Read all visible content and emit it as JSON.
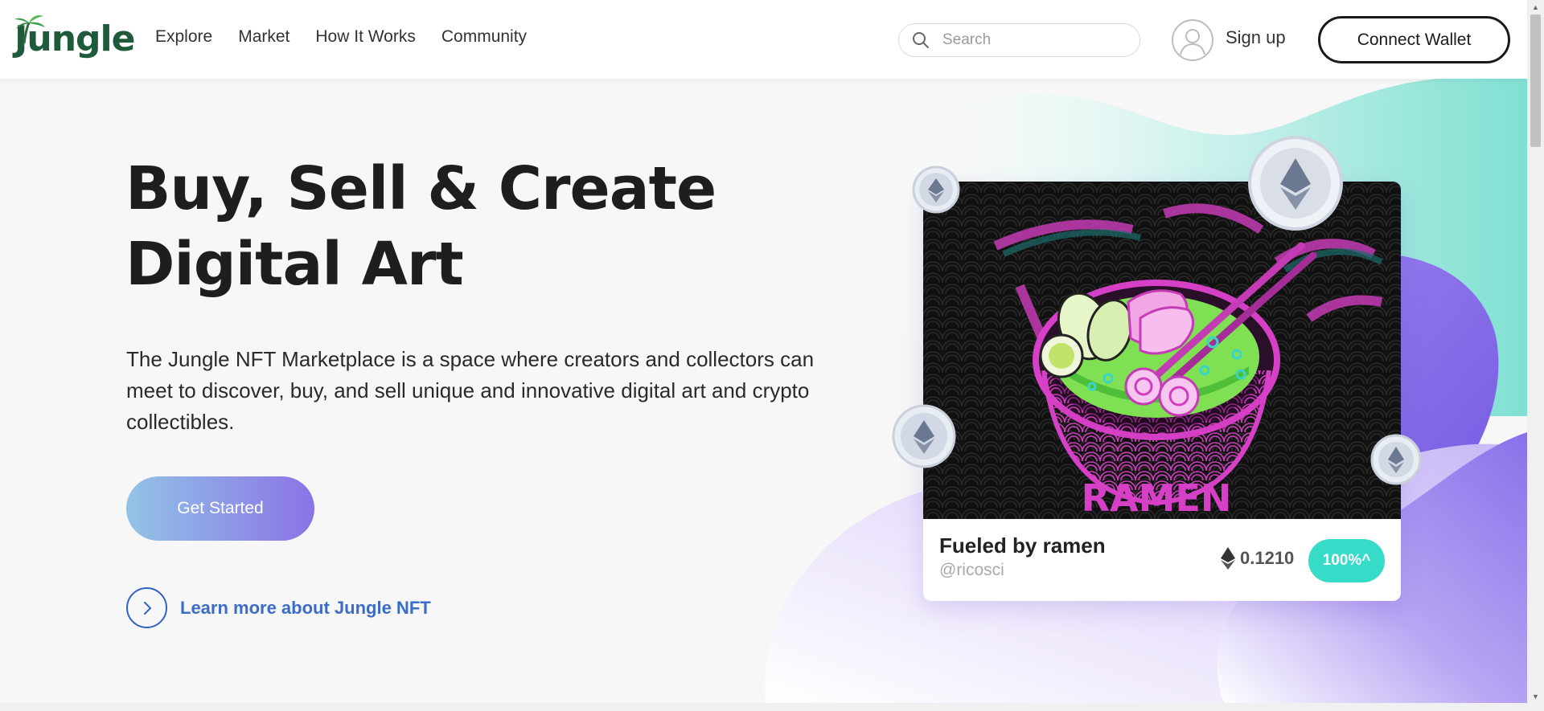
{
  "header": {
    "logo_text": "Jungle",
    "nav": [
      "Explore",
      "Market",
      "How It Works",
      "Community"
    ],
    "search_placeholder": "Search",
    "signup_label": "Sign up",
    "connect_wallet_label": "Connect Wallet"
  },
  "hero": {
    "title_line1": "Buy, Sell & Create",
    "title_line2": "Digital Art",
    "description": "The Jungle NFT Marketplace is a space where creators and collectors can meet to discover, buy, and sell unique and innovative digital art and crypto collectibles.",
    "cta_label": "Get Started",
    "learn_more_label": "Learn more about Jungle NFT"
  },
  "nft_card": {
    "title": "Fueled by ramen",
    "handle": "@ricosci",
    "price": "0.1210",
    "badge": "100%^",
    "art_text": "RAMEN"
  },
  "colors": {
    "cta_gradient_start": "#92c4e6",
    "cta_gradient_end": "#8b72e6",
    "link_blue": "#3a6cc8",
    "badge_teal": "#37dcc8",
    "logo_green": "#1f5a3a",
    "deco_mint": "#7fe0d2",
    "deco_purple": "#7b5ce5"
  },
  "icons": [
    "palm-logo-icon",
    "search-icon",
    "user-avatar-icon",
    "chevron-right-icon",
    "ethereum-icon",
    "ethereum-coin-icon"
  ]
}
